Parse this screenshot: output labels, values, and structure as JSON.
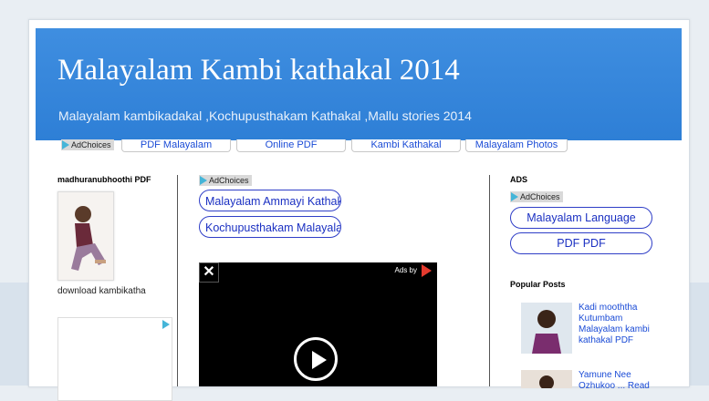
{
  "blog": {
    "title": "Malayalam Kambi kathakal 2014",
    "description": "Malayalam kambikadakal ,Kochupusthakam Kathakal ,Mallu stories 2014"
  },
  "nav": {
    "adchoices": "AdChoices",
    "links": [
      "PDF Malayalam",
      "Online PDF",
      "Kambi Kathakal",
      "Malayalam Photos"
    ]
  },
  "sidebar_left": {
    "widget_title": "madhuranubhoothi PDF",
    "caption": "download kambikatha"
  },
  "main": {
    "adchoices": "AdChoices",
    "ad_links": [
      "Malayalam Ammayi Kathakal",
      "Kochupusthakam Malayalam"
    ],
    "video": {
      "close": "✕",
      "ads_by": "Ads by"
    }
  },
  "sidebar_right": {
    "ads_title": "ADS",
    "adchoices": "AdChoices",
    "ad_links": [
      "Malayalam Language",
      "PDF PDF"
    ],
    "popular_title": "Popular Posts",
    "posts": [
      "Kadi mooththa Kutumbam Malayalam kambi kathakal PDF",
      "Yamune Nee Ozhukoo ... Read"
    ]
  },
  "colors": {
    "header": "#3f8ee0",
    "link": "#1a4bd6",
    "pill_border": "#2f3ec7",
    "adchoices_icon": "#45b5d8",
    "ads_logo": "#e53a2e"
  }
}
